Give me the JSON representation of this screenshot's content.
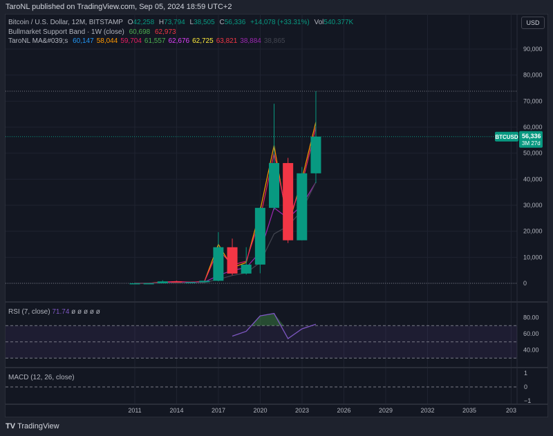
{
  "header": {
    "published": "TaroNL published on TradingView.com, Sep 05, 2024 18:59 UTC+2"
  },
  "currency_button": "USD",
  "legend": {
    "symbol": "Bitcoin / U.S. Dollar, 12M, BITSTAMP",
    "o_label": "O",
    "o": "42,258",
    "h_label": "H",
    "h": "73,794",
    "l_label": "L",
    "l": "38,505",
    "c_label": "C",
    "c": "56,336",
    "change": "+14,078 (+33.31%)",
    "vol_label": "Vol",
    "vol": "540.377K",
    "band_name": "Bullmarket Support Band · 1W (close)",
    "band_values": [
      {
        "v": "60,698",
        "color": "#4caf50"
      },
      {
        "v": "62,973",
        "color": "#f23645"
      }
    ],
    "ma_name": "TaroNL MA&#039;s",
    "ma_values": [
      {
        "v": "60,147",
        "color": "#2196f3"
      },
      {
        "v": "58,044",
        "color": "#ff9800"
      },
      {
        "v": "59,704",
        "color": "#e91e63"
      },
      {
        "v": "61,557",
        "color": "#4caf50"
      },
      {
        "v": "62,676",
        "color": "#e040fb"
      },
      {
        "v": "62,725",
        "color": "#ffeb3b"
      },
      {
        "v": "63,821",
        "color": "#f23645"
      },
      {
        "v": "38,884",
        "color": "#9c27b0"
      },
      {
        "v": "38,865",
        "color": "#434651"
      }
    ]
  },
  "price_tag": {
    "symbol": "BTCUSD",
    "price": "56,336",
    "countdown": "3M 27d",
    "color": "#089981"
  },
  "rsi": {
    "label": "RSI (7, close)",
    "value": "71.74",
    "extras": "ø ø ø ø ø",
    "ticks": [
      "80.00",
      "60.00",
      "40.00"
    ],
    "upper": 70,
    "mid": 50,
    "lower": 30,
    "x": [
      2018,
      2019,
      2020,
      2021,
      2022,
      2023,
      2024
    ],
    "values": [
      57,
      63,
      82,
      85,
      54,
      66,
      71.74
    ]
  },
  "macd": {
    "label": "MACD (12, 26, close)",
    "ticks": [
      "1",
      "0",
      "−1"
    ]
  },
  "chart_data": {
    "type": "candlestick",
    "ylim": [
      0,
      95000
    ],
    "y_ticks": [
      "90,000",
      "80,000",
      "70,000",
      "60,000",
      "50,000",
      "40,000",
      "30,000",
      "20,000",
      "10,000",
      "0"
    ],
    "x_ticks": [
      "2011",
      "2014",
      "2017",
      "2020",
      "2023",
      "2026",
      "2029",
      "2032",
      "2035",
      "203"
    ],
    "up_color": "#089981",
    "down_color": "#f23645",
    "candles": [
      {
        "x": 2011,
        "o": 0.3,
        "h": 32,
        "l": 0.3,
        "c": 4.7
      },
      {
        "x": 2012,
        "o": 4.7,
        "h": 16,
        "l": 4,
        "c": 13.5
      },
      {
        "x": 2013,
        "o": 13.5,
        "h": 1163,
        "l": 13,
        "c": 732
      },
      {
        "x": 2014,
        "o": 732,
        "h": 1000,
        "l": 300,
        "c": 318
      },
      {
        "x": 2015,
        "o": 318,
        "h": 500,
        "l": 150,
        "c": 430
      },
      {
        "x": 2016,
        "o": 430,
        "h": 980,
        "l": 350,
        "c": 963
      },
      {
        "x": 2017,
        "o": 963,
        "h": 19666,
        "l": 780,
        "c": 13860
      },
      {
        "x": 2018,
        "o": 13860,
        "h": 17178,
        "l": 3122,
        "c": 3742
      },
      {
        "x": 2019,
        "o": 3742,
        "h": 13880,
        "l": 3350,
        "c": 7194
      },
      {
        "x": 2020,
        "o": 7194,
        "h": 29300,
        "l": 3850,
        "c": 28990
      },
      {
        "x": 2021,
        "o": 28990,
        "h": 69000,
        "l": 28130,
        "c": 46200
      },
      {
        "x": 2022,
        "o": 46200,
        "h": 48190,
        "l": 15480,
        "c": 16530
      },
      {
        "x": 2023,
        "o": 16530,
        "h": 44700,
        "l": 16490,
        "c": 42258
      },
      {
        "x": 2024,
        "o": 42258,
        "h": 73794,
        "l": 38505,
        "c": 56336
      }
    ],
    "ma_lines": [
      {
        "color": "#ff9800",
        "values": [
          0,
          5,
          500,
          600,
          400,
          700,
          15000,
          6000,
          8000,
          28000,
          53000,
          22000,
          40000,
          62000
        ]
      },
      {
        "color": "#e91e63",
        "values": [
          0,
          5,
          400,
          700,
          450,
          650,
          13000,
          7000,
          8500,
          25000,
          50000,
          24000,
          38000,
          60000
        ]
      },
      {
        "color": "#9c27b0",
        "values": [
          0,
          2,
          200,
          350,
          350,
          450,
          3000,
          5000,
          6000,
          12000,
          29000,
          25000,
          30000,
          38884
        ]
      },
      {
        "color": "#434651",
        "values": [
          0,
          1,
          100,
          200,
          250,
          300,
          1500,
          3000,
          4000,
          8000,
          19000,
          22000,
          28000,
          38865
        ]
      }
    ]
  }
}
